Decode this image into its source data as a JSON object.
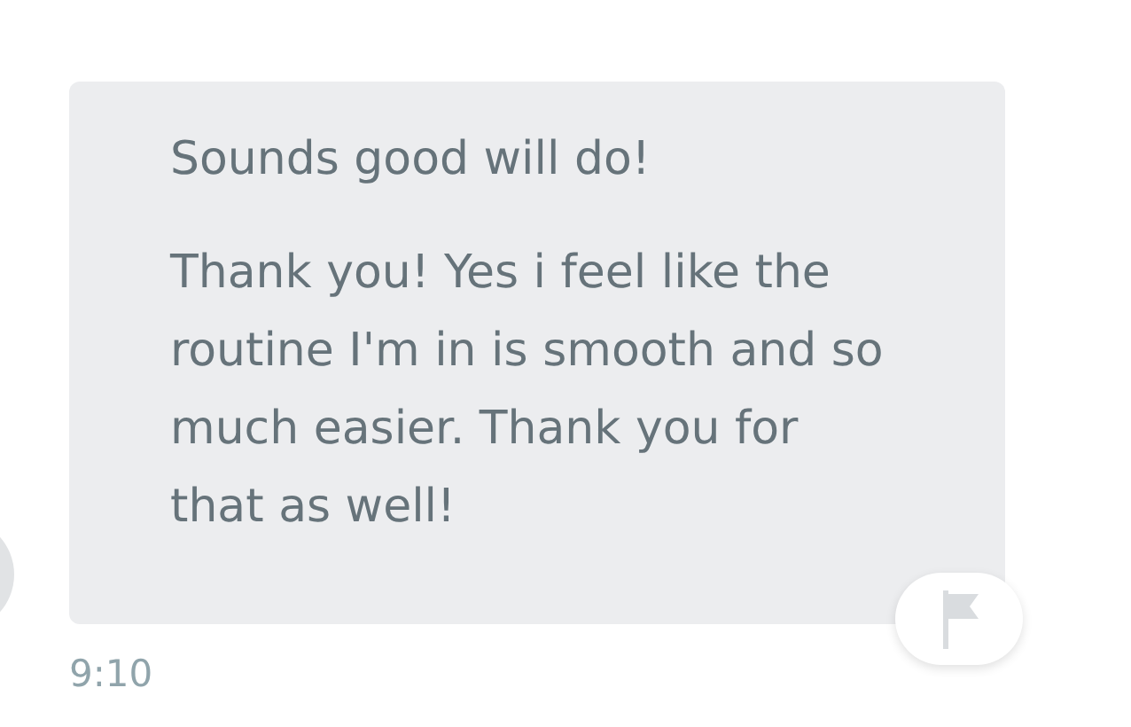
{
  "message": {
    "paragraphs": [
      "Sounds good will do!",
      "Thank you! Yes i feel like the routine I'm in is smooth and so much easier. Thank you for that as well!"
    ],
    "time": "9:10"
  }
}
